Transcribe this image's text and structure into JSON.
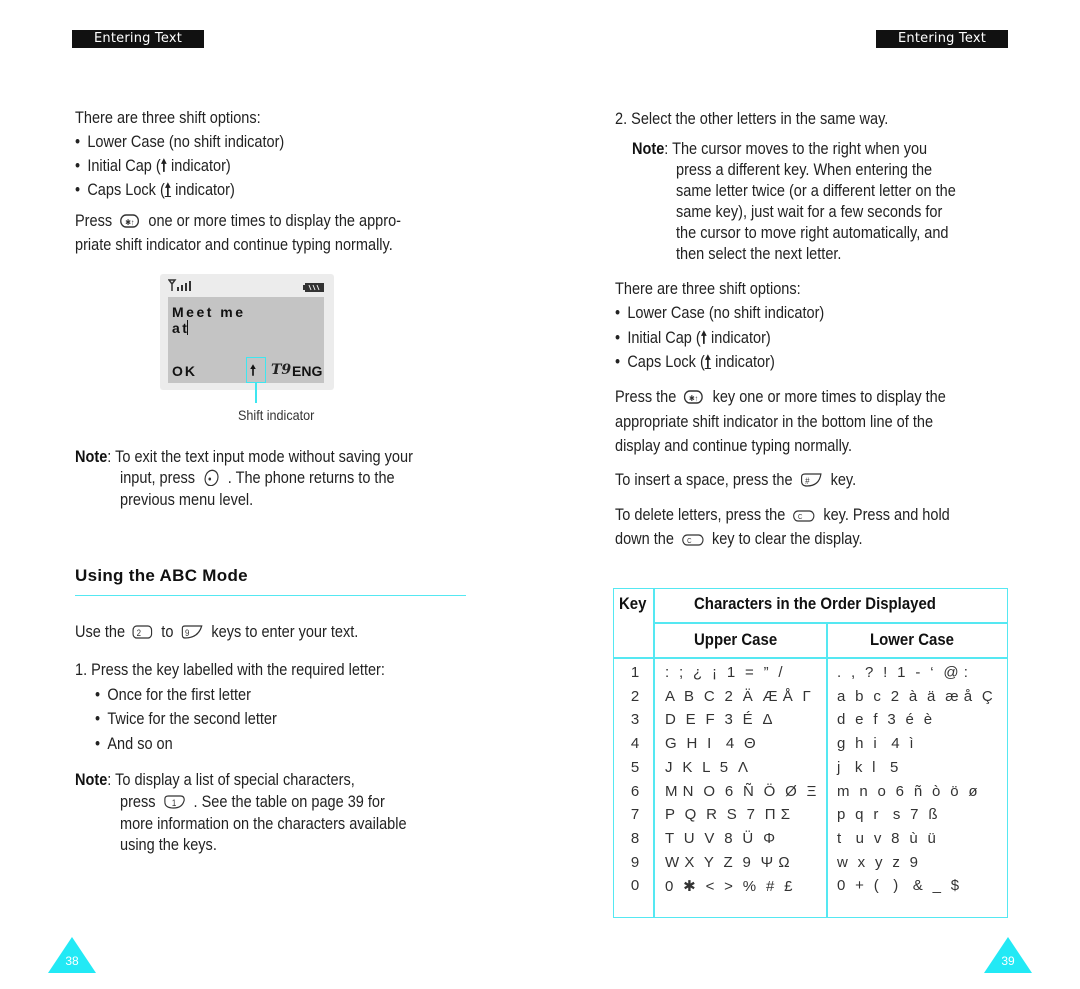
{
  "left_page": {
    "header_tab": "Entering Text",
    "shift_intro": "There are three shift options:",
    "shift_options": [
      "Lower Case (no shift indicator)",
      "Initial Cap (",
      "Caps Lock ("
    ],
    "indicator_suffix": " indicator)",
    "press_word": "Press",
    "press_rest_line1": "one or more times to display the appro-",
    "press_line2": "priate shift indicator and continue typing normally.",
    "display": {
      "text": "Meet me at",
      "softkey_left": "OK",
      "mode_icon": "T9",
      "language": "ENG",
      "caption": "Shift indicator"
    },
    "note1": {
      "label": "Note",
      "line1": ": To exit the text input mode without saving your",
      "line2a": "input, press",
      "line2b": ". The phone returns to the",
      "line3": "previous menu level."
    },
    "section_title": "Using the ABC Mode",
    "use_keys": {
      "a": "Use the",
      "b": "to",
      "c": "keys to enter your text."
    },
    "step1": "1. Press the key labelled with the required letter:",
    "step1_bullets": [
      "Once for the first letter",
      "Twice for the second letter",
      "And so on"
    ],
    "note2": {
      "label": "Note",
      "line1": ": To display a list of special characters,",
      "line2a": "press",
      "line2b": ". See the table on page 39 for",
      "line3": "more information on the characters available",
      "line4": "using the keys."
    },
    "page_number": "38"
  },
  "right_page": {
    "header_tab": "Entering Text",
    "step2": "2. Select the other letters in the same way.",
    "note": {
      "label": "Note",
      "lines": [
        ": The cursor moves to the right when you",
        "press a different key. When entering the",
        "same letter twice (or a different letter on the",
        "same key), just wait for a few seconds for",
        "the cursor to move right automatically, and",
        "then select the next letter."
      ]
    },
    "shift_intro": "There are three shift options:",
    "shift_options": [
      "Lower Case (no shift indicator)",
      "Initial Cap (",
      "Caps Lock ("
    ],
    "indicator_suffix": " indicator)",
    "press_a": "Press the",
    "press_b": "key one or more times to display the",
    "press_line2": "appropriate shift indicator in the bottom line of the",
    "press_line3": "display and continue typing normally.",
    "space_a": "To insert a space, press the",
    "space_b": "key.",
    "delete_a": "To delete letters, press the",
    "delete_b": "key. Press and hold",
    "delete_c": "down the",
    "delete_d": "key to clear the display.",
    "table": {
      "col_key": "Key",
      "col_group": "Characters in the Order Displayed",
      "col_upper": "Upper Case",
      "col_lower": "Lower Case",
      "rows": [
        {
          "key": "1",
          "upper": ":  ;  ¿  ¡  1  =  ”  /",
          "lower": ".  ,  ?  !  1  -  ‘  @ :"
        },
        {
          "key": "2",
          "upper": "A  B  C  2  Ä  Æ Å  Γ",
          "lower": "a  b  c  2  à  ä  æ å  Ç"
        },
        {
          "key": "3",
          "upper": "D  E  F  3  É  Δ",
          "lower": "d  e  f  3  é  è"
        },
        {
          "key": "4",
          "upper": "G  H  I   4  Θ",
          "lower": "g  h  i   4  ì"
        },
        {
          "key": "5",
          "upper": "J  K  L  5  Λ",
          "lower": "j   k  l   5"
        },
        {
          "key": "6",
          "upper": "M N  O  6  Ñ  Ö  Ø  Ξ",
          "lower": "m  n  o  6  ñ  ò  ö  ø"
        },
        {
          "key": "7",
          "upper": "P  Q  R  S  7  Π Σ",
          "lower": "p  q  r   s  7  ß"
        },
        {
          "key": "8",
          "upper": "T  U  V  8  Ü  Φ",
          "lower": "t   u  v  8  ù  ü"
        },
        {
          "key": "9",
          "upper": "W X  Y  Z  9  Ψ Ω",
          "lower": "w  x  y  z  9"
        },
        {
          "key": "0",
          "upper": "0  ✱  <  >  %  #  £",
          "lower": "0  +  (   )   &  _  $"
        }
      ]
    },
    "page_number": "39"
  },
  "colors": {
    "accent": "#22e9f5",
    "header_bg": "#111111",
    "screen_bg": "#c4c4c4"
  }
}
